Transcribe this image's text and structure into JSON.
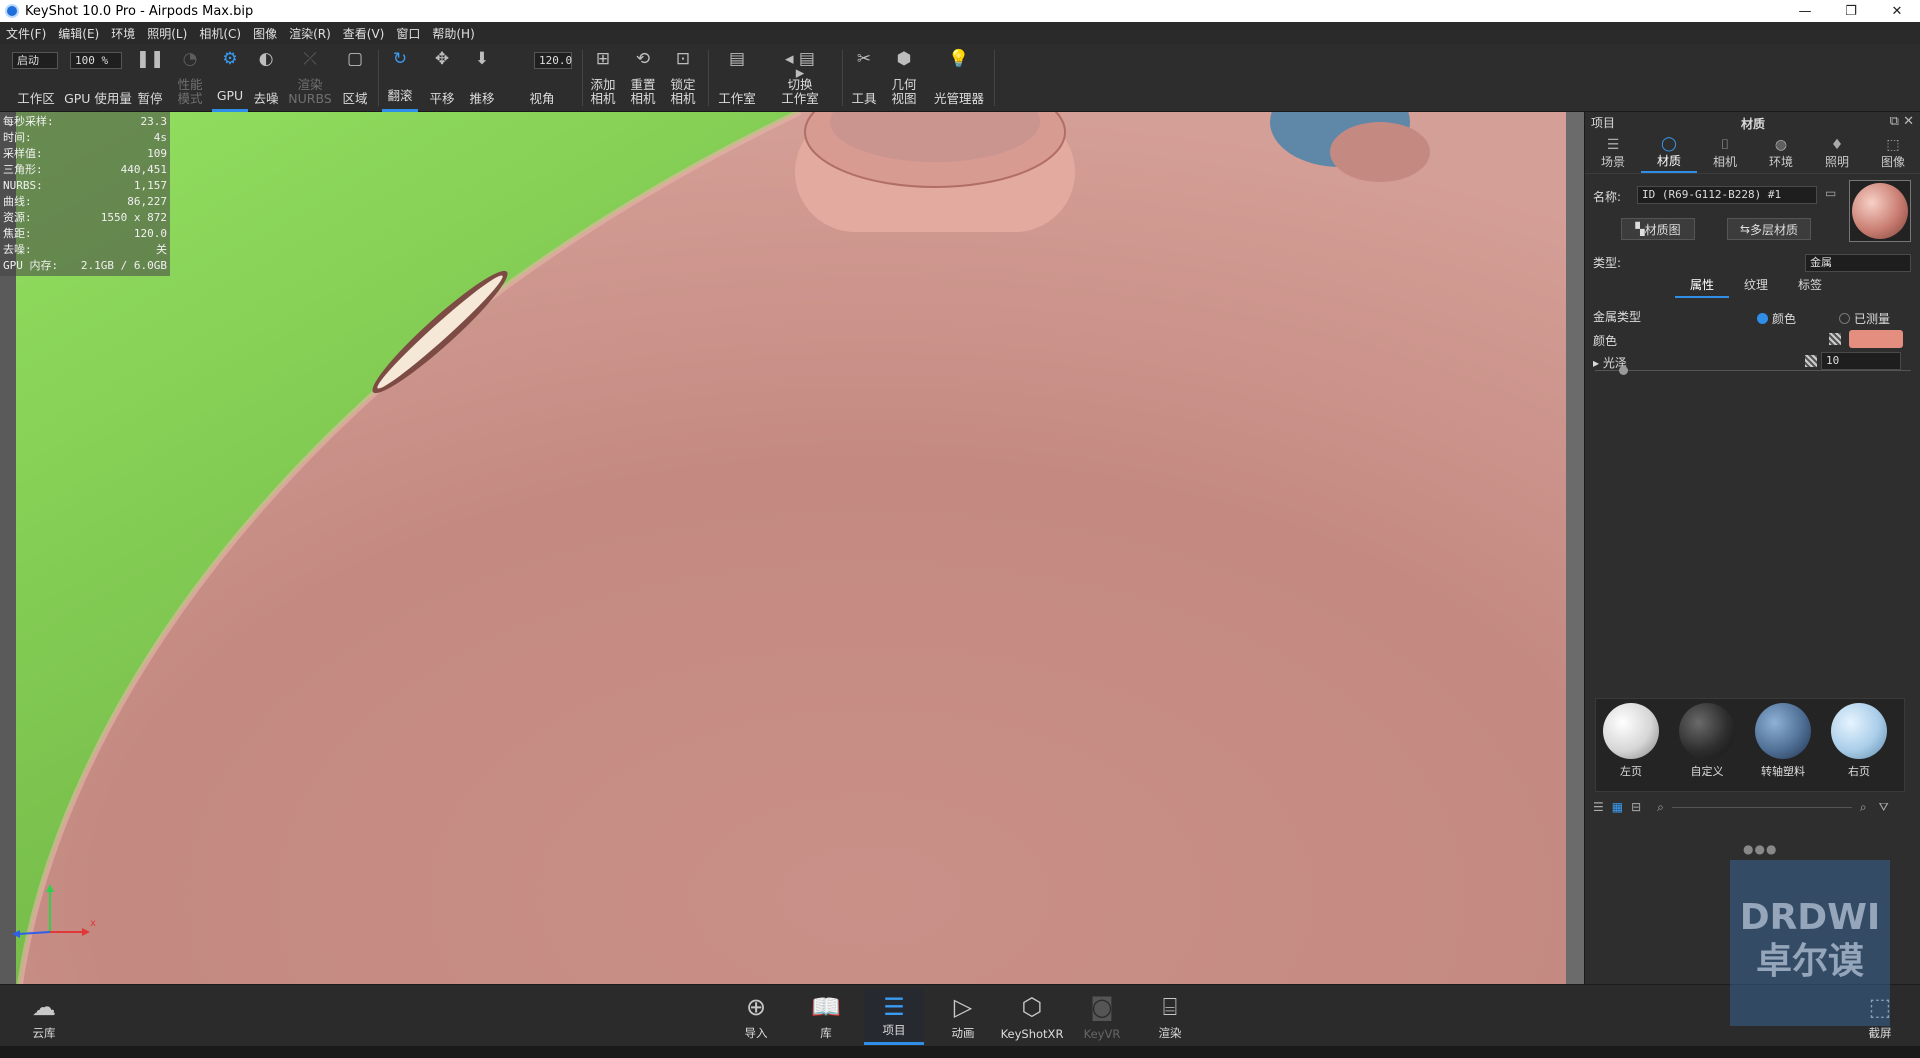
{
  "window": {
    "title": "KeyShot 10.0 Pro  - Airpods Max.bip",
    "controls": [
      "—",
      "❐",
      "✕"
    ]
  },
  "menu": [
    "文件(F)",
    "编辑(E)",
    "环境",
    "照明(L)",
    "相机(C)",
    "图像",
    "渲染(R)",
    "查看(V)",
    "窗口",
    "帮助(H)"
  ],
  "toolbar": {
    "mode_value": "启动",
    "zoom_value": "100 %",
    "fov_value": "120.0",
    "workspace": "工作区",
    "gpu_usage": "GPU 使用量",
    "pause": "暂停",
    "perf_mode_1": "性能",
    "perf_mode_2": "模式",
    "gpu": "GPU",
    "denoise": "去噪",
    "render_nurbs_1": "渲染",
    "render_nurbs_2": "NURBS",
    "region": "区域",
    "tumble": "翻滚",
    "pan": "平移",
    "dolly": "推移",
    "fov": "视角",
    "add_camera_1": "添加",
    "add_camera_2": "相机",
    "reset_camera_1": "重置",
    "reset_camera_2": "相机",
    "lock_camera_1": "锁定",
    "lock_camera_2": "相机",
    "studio": "工作室",
    "switch_studio_1": "切换",
    "switch_studio_2": "工作室",
    "tools": "工具",
    "geometry_view_1": "几何",
    "geometry_view_2": "视图",
    "light_manager": "光管理器"
  },
  "stats": [
    {
      "label": "每秒采样:",
      "value": "23.3"
    },
    {
      "label": "时间:",
      "value": "4s"
    },
    {
      "label": "采样值:",
      "value": "109"
    },
    {
      "label": "三角形:",
      "value": "440,451"
    },
    {
      "label": "NURBS:",
      "value": "1,157"
    },
    {
      "label": "曲线:",
      "value": "86,227"
    },
    {
      "label": "资源:",
      "value": "1550 x 872"
    },
    {
      "label": "焦距:",
      "value": "120.0"
    },
    {
      "label": "去噪:",
      "value": "关"
    },
    {
      "label": "GPU 内存:",
      "value": "2.1GB / 6.0GB"
    }
  ],
  "axis": {
    "z": "z",
    "x": "x"
  },
  "panel": {
    "project_label": "项目",
    "title": "材质",
    "tabs": [
      "场景",
      "材质",
      "相机",
      "环境",
      "照明",
      "图像"
    ],
    "name_label": "名称:",
    "name_value": "ID (R69-G112-B228) #1",
    "material_graph_btn": "材质图",
    "multi_layer_btn": "多层材质",
    "type_label": "类型:",
    "type_value": "金属",
    "subtabs": [
      "属性",
      "纹理",
      "标签"
    ],
    "metal_type_label": "金属类型",
    "metal_opt_color": "颜色",
    "metal_opt_measured": "已测量",
    "color_label": "颜色",
    "color_hex": "#e48e80",
    "gloss_label": "光泽",
    "gloss_value": "10",
    "gloss_level": 0.09,
    "library": [
      {
        "label": "左页",
        "color": "#e8e8e8"
      },
      {
        "label": "自定义",
        "color": "#3a3a3a"
      },
      {
        "label": "转轴塑料",
        "color": "#4f6f95"
      },
      {
        "label": "右页",
        "color": "#a9cde8"
      }
    ]
  },
  "bottom": {
    "cloud": "云库",
    "import": "导入",
    "library": "库",
    "project": "项目",
    "animation": "动画",
    "keyshotxr": "KeyShotXR",
    "keyvr": "KeyVR",
    "render": "渲染",
    "screenshot": "截屏"
  },
  "watermark": "DRDWI 卓尔谟"
}
